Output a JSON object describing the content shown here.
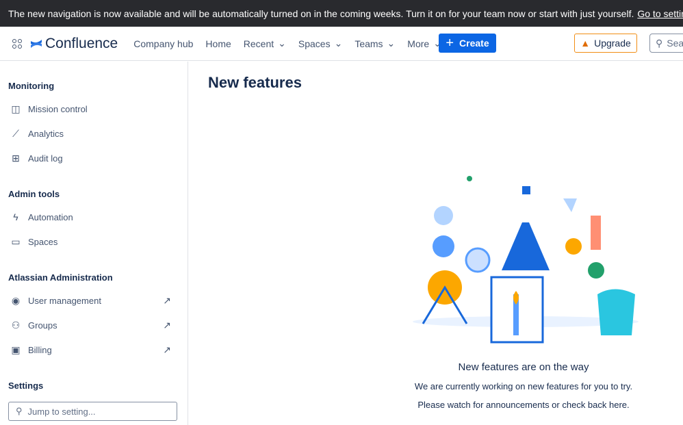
{
  "banner": {
    "text": "The new navigation is now available and will be automatically turned on in the coming weeks. Turn it on for your team now or start with just yourself.",
    "link": "Go to settings"
  },
  "header": {
    "product": "Confluence",
    "nav": [
      "Company hub",
      "Home",
      "Recent",
      "Spaces",
      "Teams",
      "More"
    ],
    "create": "Create",
    "upgrade": "Upgrade",
    "search_placeholder": "Search"
  },
  "sidebar": {
    "monitoring": {
      "title": "Monitoring",
      "items": [
        "Mission control",
        "Analytics",
        "Audit log"
      ]
    },
    "admin": {
      "title": "Admin tools",
      "items": [
        "Automation",
        "Spaces"
      ]
    },
    "atlassian": {
      "title": "Atlassian Administration",
      "items": [
        "User management",
        "Groups",
        "Billing"
      ]
    },
    "settings": {
      "title": "Settings",
      "placeholder": "Jump to setting..."
    }
  },
  "main": {
    "title": "New features",
    "empty_title": "New features are on the way",
    "line1": "We are currently working on new features for you to try.",
    "line2": "Please watch for announcements or check back here."
  }
}
